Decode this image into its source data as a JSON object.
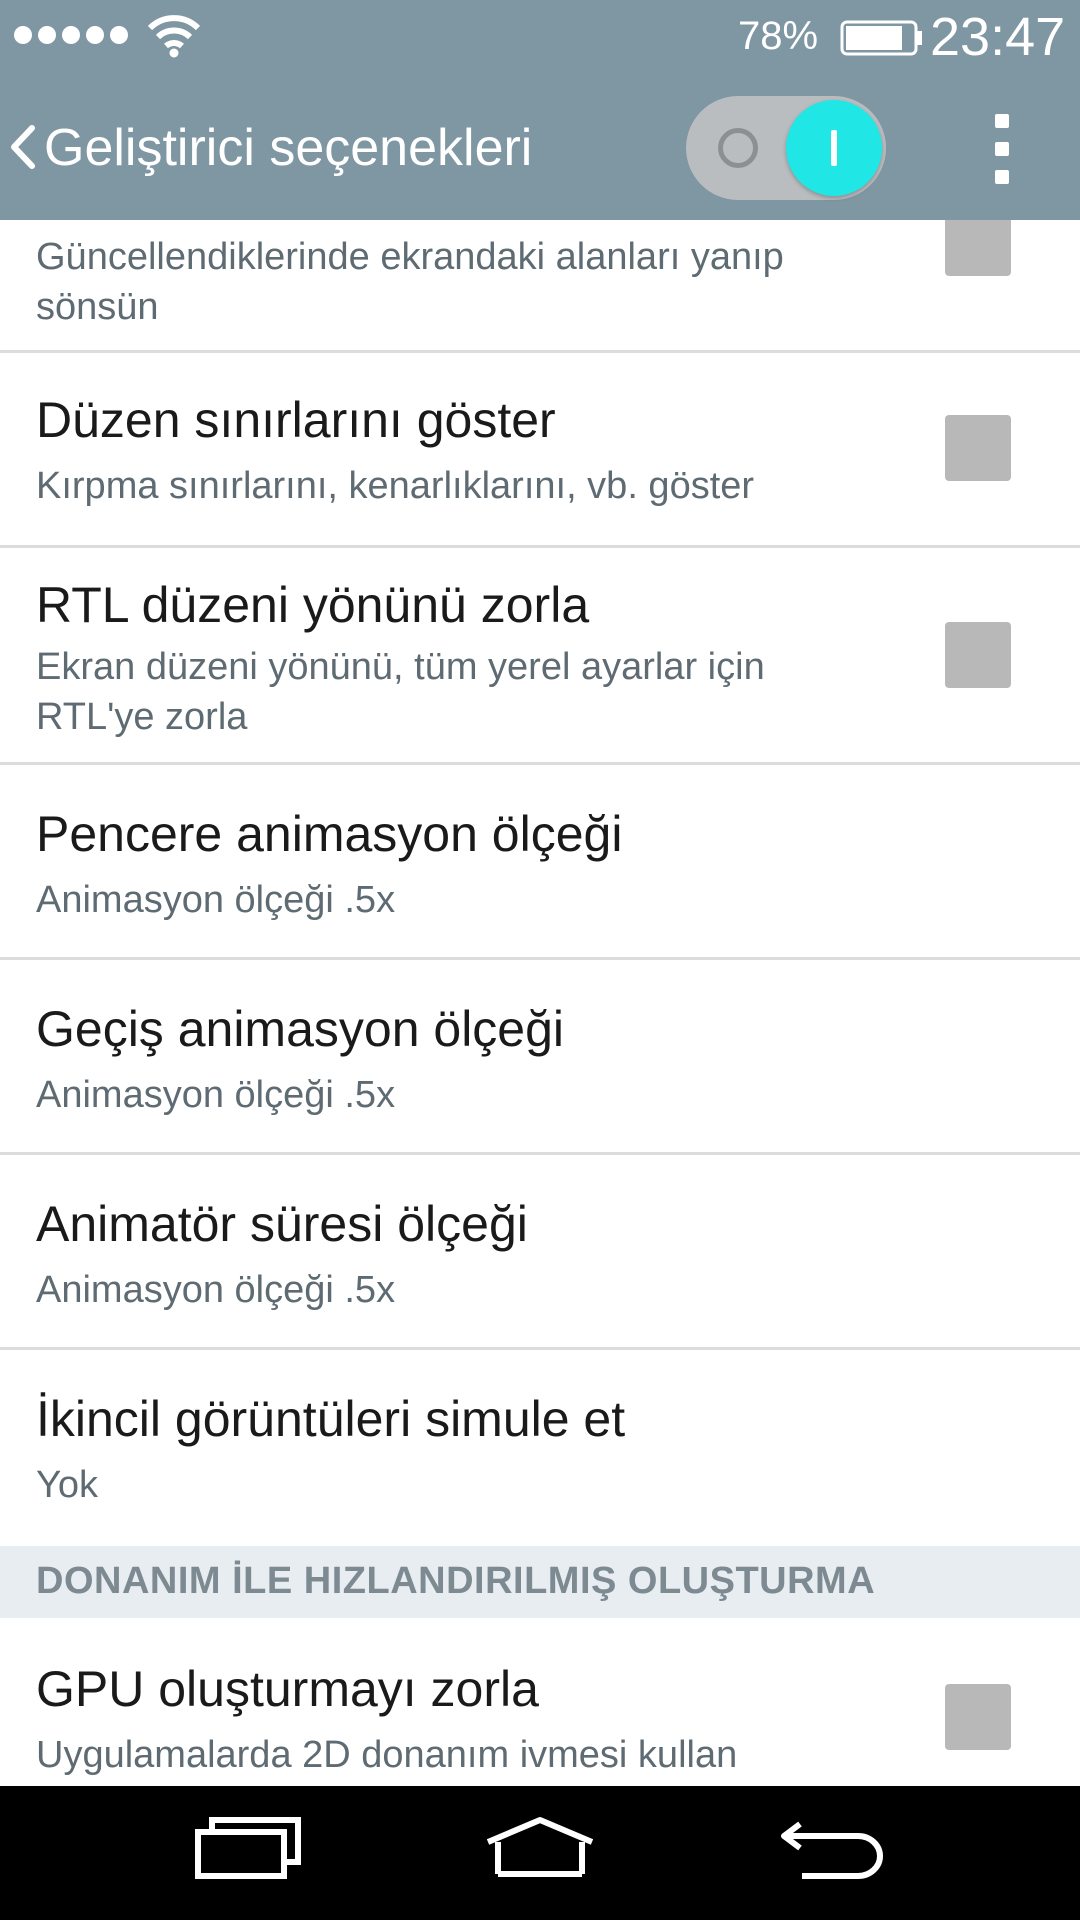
{
  "status_bar": {
    "battery_percent": "78%",
    "time": "23:47",
    "icons": [
      "signal-dots-icon",
      "wifi-icon",
      "battery-icon"
    ]
  },
  "action_bar": {
    "title": "Geliştirici seçenekleri",
    "master_switch_on": true,
    "accent_color": "#21e6e6",
    "bar_color": "#7f96a3"
  },
  "settings": {
    "partial": {
      "subtitle": "Güncellendiklerinde ekrandaki alanları yanıp sönsün",
      "checked": false
    },
    "layout_bounds": {
      "title": "Düzen sınırlarını göster",
      "subtitle": "Kırpma sınırlarını, kenarlıklarını, vb. göster",
      "checked": false
    },
    "rtl": {
      "title": "RTL düzeni yönünü zorla",
      "subtitle": "Ekran düzeni yönünü, tüm yerel ayarlar için RTL'ye zorla",
      "checked": false
    },
    "window_anim": {
      "title": "Pencere animasyon ölçeği",
      "subtitle": "Animasyon ölçeği .5x"
    },
    "transition_anim": {
      "title": "Geçiş animasyon ölçeği",
      "subtitle": "Animasyon ölçeği .5x"
    },
    "animator_duration": {
      "title": "Animatör süresi ölçeği",
      "subtitle": "Animasyon ölçeği .5x"
    },
    "secondary_displays": {
      "title": "İkincil görüntüleri simule et",
      "subtitle": "Yok"
    },
    "section_header": "DONANIM İLE HIZLANDIRILMIŞ OLUŞTURMA",
    "force_gpu": {
      "title": "GPU oluşturmayı zorla",
      "subtitle": "Uygulamalarda 2D donanım ivmesi kullan",
      "checked": false
    }
  },
  "nav_bar": {
    "icons": [
      "recents-icon",
      "home-icon",
      "back-icon"
    ]
  }
}
